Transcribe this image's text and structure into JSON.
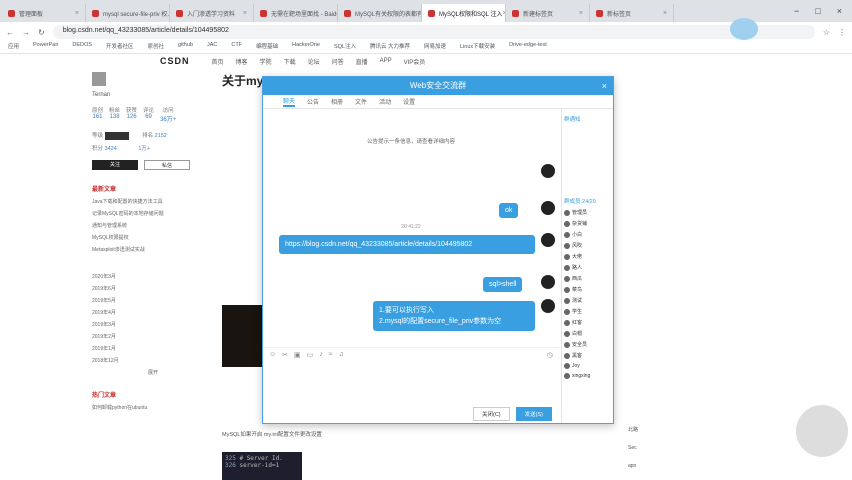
{
  "browser": {
    "tabs": [
      {
        "label": "管理面板"
      },
      {
        "label": "mysql secure-file-priv 权..."
      },
      {
        "label": "入门渗透学习资料"
      },
      {
        "label": "无需在靶场里面找 - Baidu"
      },
      {
        "label": "MySQL有关权限的表都有哪几个..."
      },
      {
        "label": "MySQL权限和SQL 注入"
      },
      {
        "label": "新建标签页"
      },
      {
        "label": "新标签页"
      }
    ],
    "url": "blog.csdn.net/qq_43233085/article/details/104495802",
    "bookmarks": [
      "应用",
      "PowerPan",
      "DEDOS",
      "开发者社区",
      "原创社",
      "github",
      "JAC",
      "CTF",
      "编程基础",
      "HackerOne",
      "SQL注入",
      "腾讯云 大力推荐",
      "网易加速",
      "Linux下载安装",
      "Drive-edge-test"
    ]
  },
  "csdn": {
    "logo": "CSDN",
    "nav": [
      "首页",
      "博客",
      "学院",
      "下载",
      "论坛",
      "问答",
      "直播",
      "APP",
      "VIP会员"
    ]
  },
  "profile": {
    "name": "Ternan",
    "stats": [
      {
        "label": "原创",
        "value": "161"
      },
      {
        "label": "粉丝",
        "value": "138"
      },
      {
        "label": "获赞",
        "value": "126"
      },
      {
        "label": "评论",
        "value": "69"
      },
      {
        "label": "访问",
        "value": "36万+"
      }
    ],
    "level_label": "等级",
    "points_label": "积分",
    "points": "3424",
    "rank_label": "排名",
    "rank": "2152",
    "total_rank": "1万+",
    "follow_btn": "关注",
    "msg_btn": "私信",
    "recent_title": "最新文章",
    "recent": [
      "Java下载和配置的快捷方法工具",
      "记录MySQL密码的本地存储问题",
      "通知与管理系统",
      "MySQL权限提权",
      "Metasploit渗透测试实战"
    ],
    "archive": [
      "2020年3月",
      "2019年6月",
      "2019年5月",
      "2019年4月",
      "2019年3月",
      "2019年2月",
      "2019年1月",
      "2018年12月"
    ],
    "archive_more": "展开",
    "hot_title": "热门文章",
    "hot": [
      "如何卸载python在ubuntu"
    ]
  },
  "article": {
    "title": "关于my",
    "para": "MySQL如果开启 my.ini配置文件更改设置",
    "code": [
      "# Server Id.",
      "server-id=1"
    ],
    "line_nums": [
      "325",
      "326"
    ]
  },
  "chat": {
    "window_title": "Web安全交流群",
    "close_label": "×",
    "tabs": [
      "聊天",
      "公告",
      "相册",
      "文件",
      "活动",
      "设置"
    ],
    "active_tab": 0,
    "notice": "公告提示一条信息，请查看详细内容",
    "time": "20:41:22",
    "messages": [
      {
        "text": "ok"
      },
      {
        "text": "https://blog.csdn.net/qq_43233085/article/details/104495802"
      },
      {
        "text": "sql>shell"
      },
      {
        "text": "1.要可以执行写入"
      },
      {
        "text": "2.mysql的配置secure_file_priv参数为空"
      }
    ],
    "toolbar_icons": [
      "emoji-icon",
      "cut-icon",
      "image-icon",
      "folder-icon",
      "shake-icon"
    ],
    "close_btn": "关闭(C)",
    "send_btn": "发送(S)",
    "members_header": "群通知",
    "members_count_label": "群成员 24/29",
    "members": [
      "管理员",
      "杂货铺",
      "小白",
      "风吹",
      "大佬",
      "路人",
      "西瓜",
      "菜鸟",
      "测试",
      "学生",
      "红客",
      "白帽",
      "安全员",
      "黑客",
      "Joy",
      "xingxing"
    ]
  },
  "right": {
    "items": [
      "北路",
      "Sec",
      "apn"
    ]
  }
}
